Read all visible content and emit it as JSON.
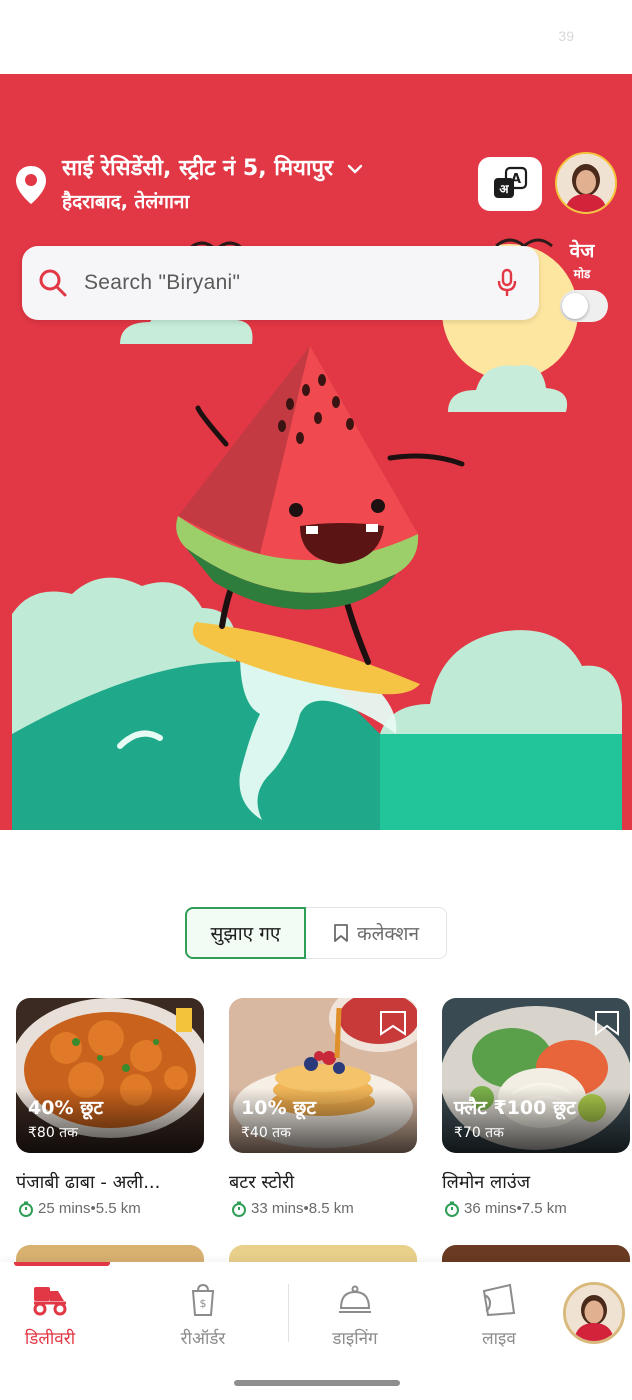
{
  "status_bar": {
    "number": "39"
  },
  "header": {
    "address_line1": "साई रेसिडेंसी, स्ट्रीट नं 5, मियापुर",
    "address_line2": "हैदराबाद, तेलंगाना",
    "language_icon": "language-translate-icon",
    "profile_icon": "profile-avatar"
  },
  "search": {
    "placeholder": "Search \"Biryani\"",
    "search_icon": "search-icon",
    "mic_icon": "mic-icon"
  },
  "veg_mode": {
    "label": "वेज",
    "sublabel": "मोड",
    "enabled": false
  },
  "tabs": [
    {
      "label": "सुझाए गए",
      "active": true
    },
    {
      "label": "कलेक्शन",
      "active": false,
      "icon": "bookmark-icon"
    }
  ],
  "restaurants": [
    {
      "name": "पंजाबी ढाबा - अली...",
      "offer": "40% छूट",
      "offer_cap": "₹80 तक",
      "time": "25 mins",
      "distance": "5.5 km",
      "meta": "25 mins•5.5 km"
    },
    {
      "name": "बटर स्टोरी",
      "offer": "10% छूट",
      "offer_cap": "₹40 तक",
      "time": "33 mins",
      "distance": "8.5 km",
      "meta": "33 mins•8.5 km"
    },
    {
      "name": "लिमोन लाउंज",
      "offer": "फ्लैट ₹100 छूट",
      "offer_cap": "₹70 तक",
      "time": "36 mins",
      "distance": "7.5 km",
      "meta": "36 mins•7.5 km"
    }
  ],
  "bottom_nav": [
    {
      "label": "डिलीवरी",
      "icon": "delivery-scooter-icon",
      "active": true
    },
    {
      "label": "रीऑर्डर",
      "icon": "reorder-bag-icon",
      "active": false
    },
    {
      "label": "डाइनिंग",
      "icon": "dining-cloche-icon",
      "active": false
    },
    {
      "label": "लाइव",
      "icon": "live-ticket-icon",
      "active": false
    }
  ],
  "colors": {
    "brand_red": "#e23744",
    "veg_green": "#2f9e57",
    "text_dark": "#1c1c1c",
    "text_muted": "#6b6b6b"
  }
}
